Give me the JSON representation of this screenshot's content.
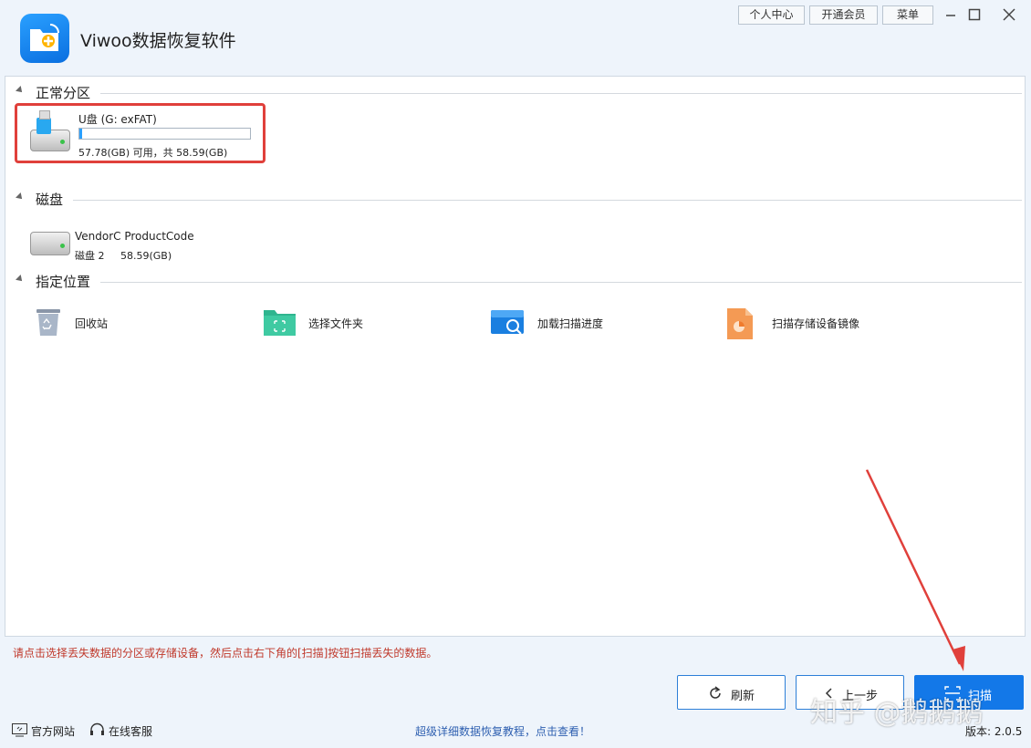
{
  "app": {
    "title": "Viwoo数据恢复软件"
  },
  "top_buttons": {
    "personal_center": "个人中心",
    "membership": "开通会员",
    "menu": "菜单"
  },
  "sections": {
    "normal_partitions": {
      "label": "正常分区",
      "partition": {
        "name": "U盘 (G: exFAT)",
        "size": "57.78(GB) 可用，共 58.59(GB)",
        "used_fraction": 0.014
      }
    },
    "disks": {
      "label": "磁盘",
      "disk": {
        "name": "VendorC ProductCode",
        "sub": "磁盘 2     58.59(GB)"
      }
    },
    "locations": {
      "label": "指定位置",
      "items": [
        {
          "label": "回收站",
          "icon": "recycle-bin-icon"
        },
        {
          "label": "选择文件夹",
          "icon": "folder-icon"
        },
        {
          "label": "加载扫描进度",
          "icon": "scan-progress-icon"
        },
        {
          "label": "扫描存储设备镜像",
          "icon": "disk-image-icon"
        }
      ]
    }
  },
  "hint": "请点击选择丢失数据的分区或存储设备，然后点击右下角的[扫描]按钮扫描丢失的数据。",
  "buttons": {
    "refresh": "刷新",
    "prev": "上一步",
    "scan": "扫描"
  },
  "status_bar": {
    "website": "官方网站",
    "support": "在线客服",
    "tutorial_link": "超级详细数据恢复教程，点击查看！",
    "version": "版本: 2.0.5"
  },
  "watermark": "知乎 @鹅鹅鹅",
  "colors": {
    "accent": "#1378e8",
    "highlight_border": "#e0403b",
    "hint_text": "#c0392b"
  }
}
